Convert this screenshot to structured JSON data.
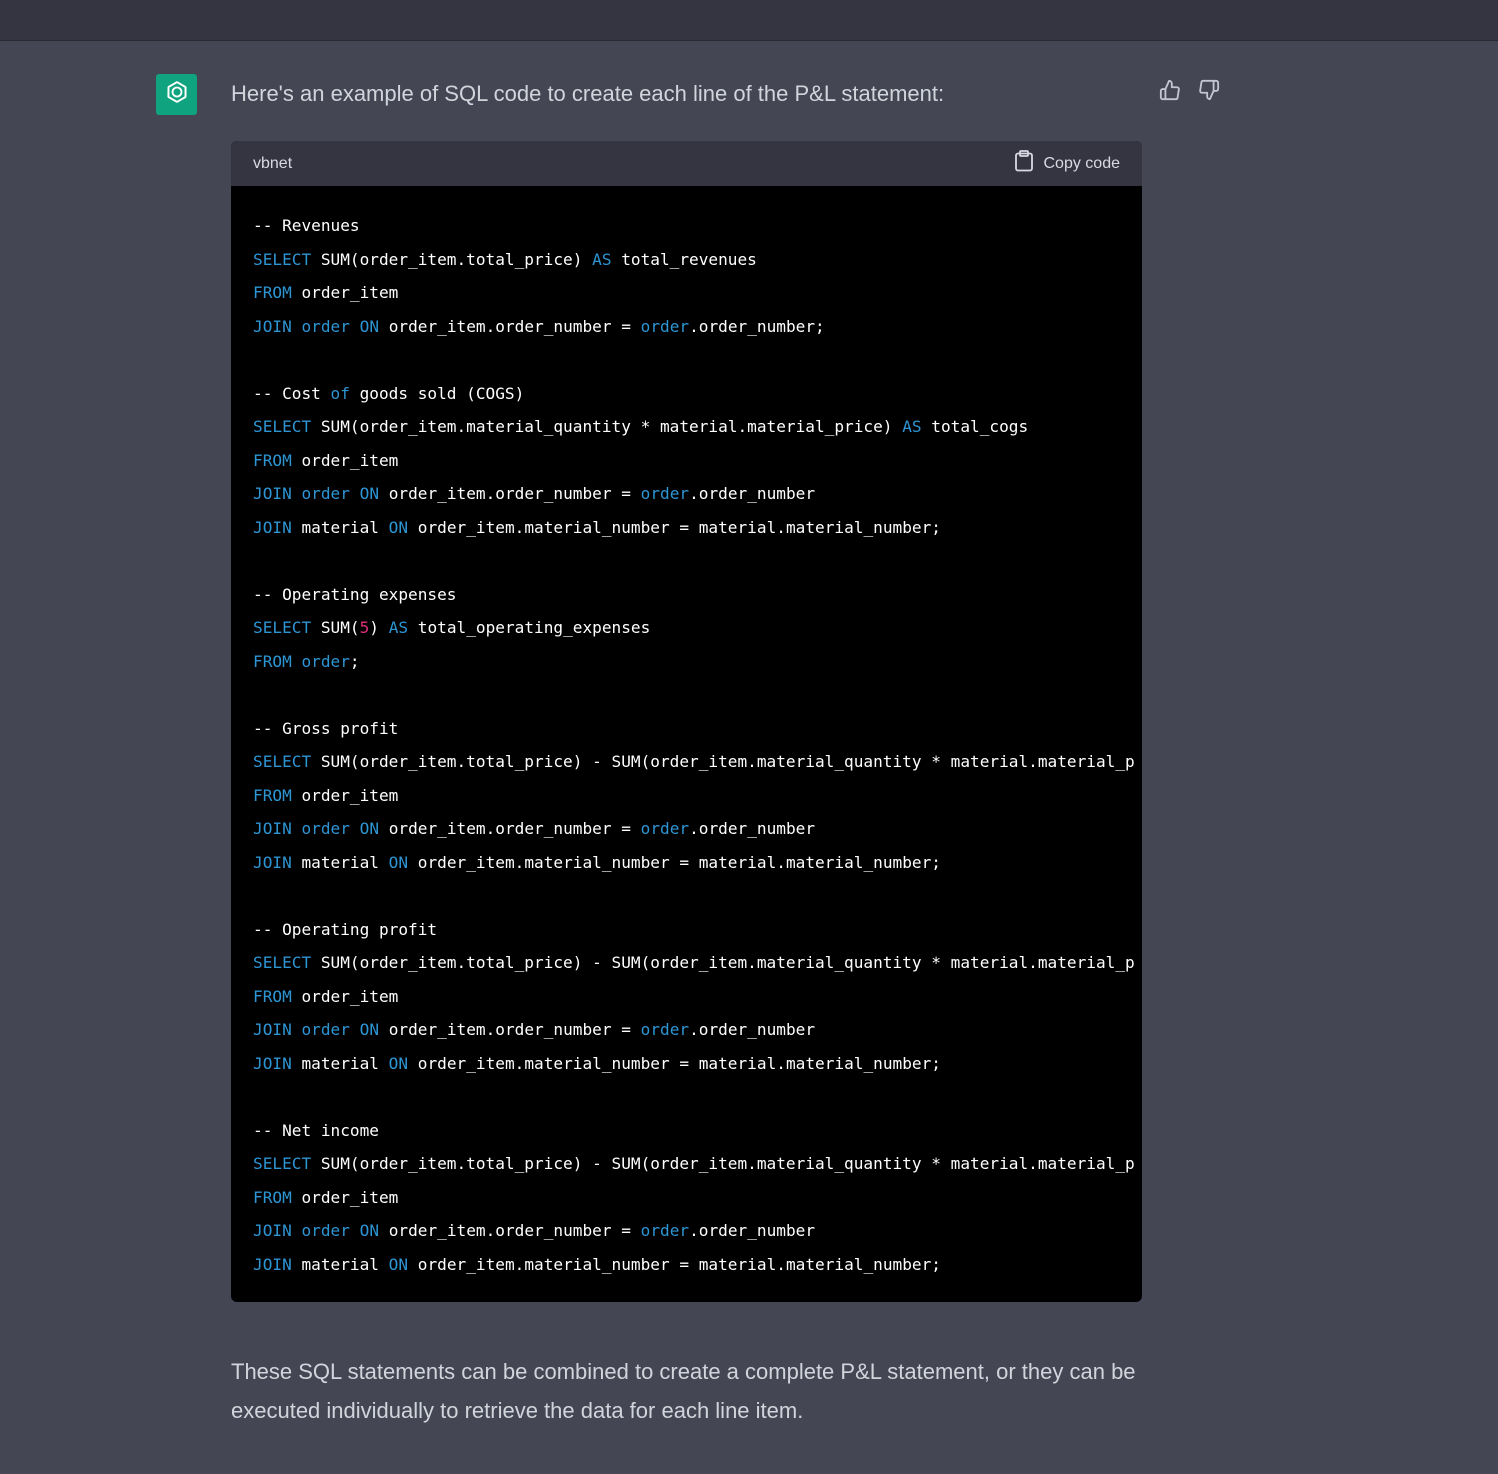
{
  "message": {
    "intro": "Here's an example of SQL code to create each line of the P&L statement:",
    "outro": "These SQL statements can be combined to create a complete P&L statement, or they can be executed individually to retrieve the data for each line item."
  },
  "feedback": {
    "up_icon": "thumbs-up-icon",
    "down_icon": "thumbs-down-icon"
  },
  "code_block": {
    "language": "vbnet",
    "copy_label": "Copy code",
    "lines": [
      [
        {
          "t": "-- Revenues"
        }
      ],
      [
        {
          "t": "SELECT",
          "k": 1
        },
        {
          "t": " SUM(order_item.total_price) "
        },
        {
          "t": "AS",
          "k": 1
        },
        {
          "t": " total_revenues"
        }
      ],
      [
        {
          "t": "FROM",
          "k": 1
        },
        {
          "t": " order_item"
        }
      ],
      [
        {
          "t": "JOIN",
          "k": 1
        },
        {
          "t": " "
        },
        {
          "t": "order",
          "k": 1
        },
        {
          "t": " "
        },
        {
          "t": "ON",
          "k": 1
        },
        {
          "t": " order_item.order_number = "
        },
        {
          "t": "order",
          "k": 1
        },
        {
          "t": ".order_number;"
        }
      ],
      [],
      [
        {
          "t": "-- Cost "
        },
        {
          "t": "of",
          "k": 1
        },
        {
          "t": " goods sold (COGS)"
        }
      ],
      [
        {
          "t": "SELECT",
          "k": 1
        },
        {
          "t": " SUM(order_item.material_quantity * material.material_price) "
        },
        {
          "t": "AS",
          "k": 1
        },
        {
          "t": " total_cogs"
        }
      ],
      [
        {
          "t": "FROM",
          "k": 1
        },
        {
          "t": " order_item"
        }
      ],
      [
        {
          "t": "JOIN",
          "k": 1
        },
        {
          "t": " "
        },
        {
          "t": "order",
          "k": 1
        },
        {
          "t": " "
        },
        {
          "t": "ON",
          "k": 1
        },
        {
          "t": " order_item.order_number = "
        },
        {
          "t": "order",
          "k": 1
        },
        {
          "t": ".order_number"
        }
      ],
      [
        {
          "t": "JOIN",
          "k": 1
        },
        {
          "t": " material "
        },
        {
          "t": "ON",
          "k": 1
        },
        {
          "t": " order_item.material_number = material.material_number;"
        }
      ],
      [],
      [
        {
          "t": "-- Operating expenses"
        }
      ],
      [
        {
          "t": "SELECT",
          "k": 1
        },
        {
          "t": " SUM("
        },
        {
          "t": "5",
          "n": 1
        },
        {
          "t": ") "
        },
        {
          "t": "AS",
          "k": 1
        },
        {
          "t": " total_operating_expenses"
        }
      ],
      [
        {
          "t": "FROM",
          "k": 1
        },
        {
          "t": " "
        },
        {
          "t": "order",
          "k": 1
        },
        {
          "t": ";"
        }
      ],
      [],
      [
        {
          "t": "-- Gross profit"
        }
      ],
      [
        {
          "t": "SELECT",
          "k": 1
        },
        {
          "t": " SUM(order_item.total_price) - SUM(order_item.material_quantity * material.material_p"
        }
      ],
      [
        {
          "t": "FROM",
          "k": 1
        },
        {
          "t": " order_item"
        }
      ],
      [
        {
          "t": "JOIN",
          "k": 1
        },
        {
          "t": " "
        },
        {
          "t": "order",
          "k": 1
        },
        {
          "t": " "
        },
        {
          "t": "ON",
          "k": 1
        },
        {
          "t": " order_item.order_number = "
        },
        {
          "t": "order",
          "k": 1
        },
        {
          "t": ".order_number"
        }
      ],
      [
        {
          "t": "JOIN",
          "k": 1
        },
        {
          "t": " material "
        },
        {
          "t": "ON",
          "k": 1
        },
        {
          "t": " order_item.material_number = material.material_number;"
        }
      ],
      [],
      [
        {
          "t": "-- Operating profit"
        }
      ],
      [
        {
          "t": "SELECT",
          "k": 1
        },
        {
          "t": " SUM(order_item.total_price) - SUM(order_item.material_quantity * material.material_p"
        }
      ],
      [
        {
          "t": "FROM",
          "k": 1
        },
        {
          "t": " order_item"
        }
      ],
      [
        {
          "t": "JOIN",
          "k": 1
        },
        {
          "t": " "
        },
        {
          "t": "order",
          "k": 1
        },
        {
          "t": " "
        },
        {
          "t": "ON",
          "k": 1
        },
        {
          "t": " order_item.order_number = "
        },
        {
          "t": "order",
          "k": 1
        },
        {
          "t": ".order_number"
        }
      ],
      [
        {
          "t": "JOIN",
          "k": 1
        },
        {
          "t": " material "
        },
        {
          "t": "ON",
          "k": 1
        },
        {
          "t": " order_item.material_number = material.material_number;"
        }
      ],
      [],
      [
        {
          "t": "-- Net income"
        }
      ],
      [
        {
          "t": "SELECT",
          "k": 1
        },
        {
          "t": " SUM(order_item.total_price) - SUM(order_item.material_quantity * material.material_p"
        }
      ],
      [
        {
          "t": "FROM",
          "k": 1
        },
        {
          "t": " order_item"
        }
      ],
      [
        {
          "t": "JOIN",
          "k": 1
        },
        {
          "t": " "
        },
        {
          "t": "order",
          "k": 1
        },
        {
          "t": " "
        },
        {
          "t": "ON",
          "k": 1
        },
        {
          "t": " order_item.order_number = "
        },
        {
          "t": "order",
          "k": 1
        },
        {
          "t": ".order_number"
        }
      ],
      [
        {
          "t": "JOIN",
          "k": 1
        },
        {
          "t": " material "
        },
        {
          "t": "ON",
          "k": 1
        },
        {
          "t": " order_item.material_number = material.material_number;"
        }
      ]
    ]
  },
  "colors": {
    "background": "#444654",
    "topbar": "#343541",
    "avatar": "#10a37f",
    "code_bg": "#000000",
    "keyword": "#2e95d3",
    "number": "#df3079"
  }
}
